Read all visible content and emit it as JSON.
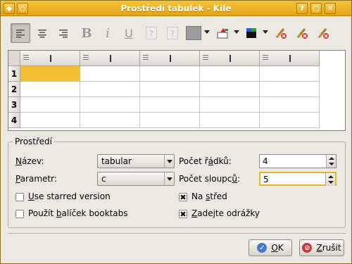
{
  "window": {
    "title": "Prostředí tabulek - Kile"
  },
  "toolbar": {
    "bold": "B",
    "italic": "i",
    "underline": "U",
    "icons": [
      "align-left-icon",
      "align-center-icon",
      "align-right-icon",
      "bold-icon",
      "italic-icon",
      "underline-icon",
      "multicolumn-icon",
      "multirow-icon",
      "color-swatch-icon",
      "paint-icon",
      "text-color-icon",
      "clear-all-icon",
      "clear-text-icon",
      "clear-attributes-icon"
    ],
    "accent": "#f3be33"
  },
  "grid": {
    "row_numbers": [
      "1",
      "2",
      "3",
      "4"
    ],
    "column_count": 5
  },
  "group": {
    "title": "Prostředí",
    "name_label_u": "N",
    "name_label_rest": "ázev:",
    "name_value": "tabular",
    "param_label_u": "P",
    "param_label_rest": "arametr:",
    "param_value": "c",
    "rows_label_pre": "Počet ř",
    "rows_label_u": "á",
    "rows_label_post": "dků:",
    "rows_value": "4",
    "cols_label_pre": "Počet sloupc",
    "cols_label_u": "ů",
    "cols_label_post": ":",
    "cols_value": "5",
    "starred_u": "U",
    "starred_rest": "se starred version",
    "booktabs_pre": "Použít ",
    "booktabs_u": "b",
    "booktabs_post": "alíček booktabs",
    "center_pre": "Na ",
    "center_u": "s",
    "center_post": "třed",
    "bullets_u": "Z",
    "bullets_rest": "adejte odrážky"
  },
  "buttons": {
    "ok_u": "O",
    "ok_rest": "K",
    "cancel_u": "Z",
    "cancel_rest": "rušit"
  }
}
